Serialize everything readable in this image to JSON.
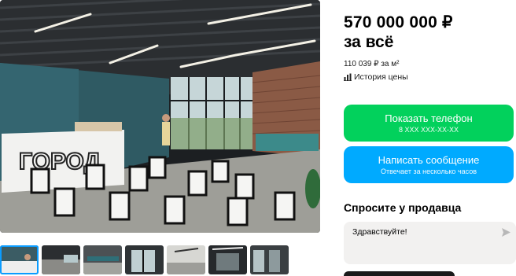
{
  "listing": {
    "price": "570 000 000 ₽",
    "price_note": "за всё",
    "price_per_m2": "110 039 ₽ за м²",
    "price_history": "История цены"
  },
  "contact": {
    "phone_button": "Показать телефон",
    "phone_mask": "8 XXX XXX-XX-XX",
    "message_button": "Написать сообщение",
    "message_note": "Отвечает за несколько часов"
  },
  "ask_seller": {
    "title": "Спросите у продавца",
    "input_value": "Здравствуйте!"
  },
  "gallery": {
    "sign_text": "ГОРОД",
    "thumbnail_count": 7
  },
  "colors": {
    "phone_button": "#02d15c",
    "message_button": "#00aaff"
  },
  "icons": {
    "history": "bar-chart-icon",
    "send": "send-arrow-icon"
  }
}
